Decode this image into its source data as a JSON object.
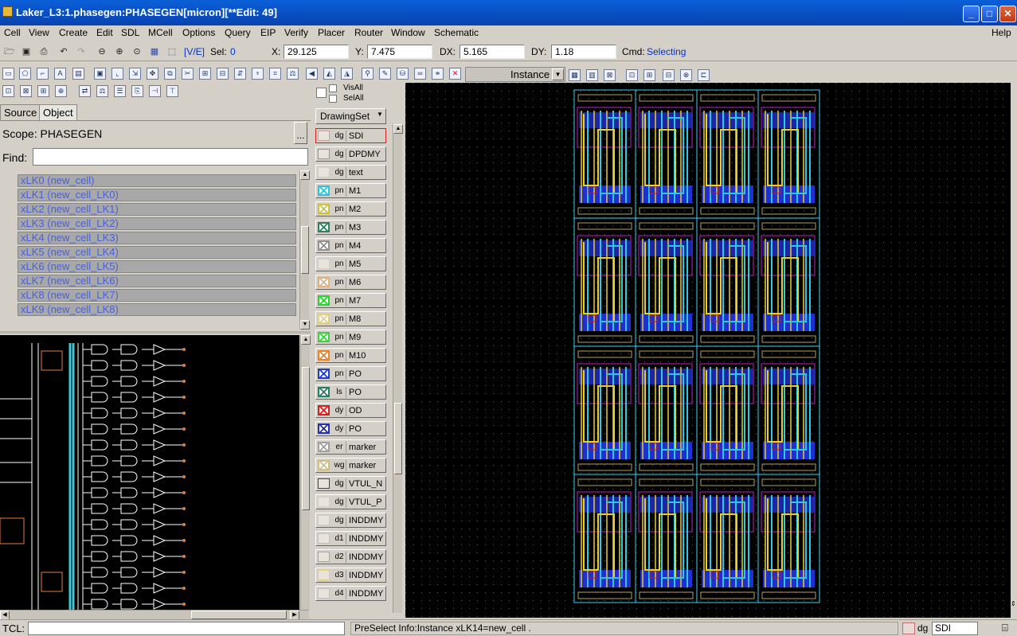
{
  "window": {
    "title": "Laker_L3:1.phasegen:PHASEGEN[micron][**Edit: 49]"
  },
  "menu": [
    "Cell",
    "View",
    "Create",
    "Edit",
    "SDL",
    "MCell",
    "Options",
    "Query",
    "EIP",
    "Verify",
    "Placer",
    "Router",
    "Window",
    "Schematic"
  ],
  "menu_help": "Help",
  "coords": {
    "mode": "[V/E]",
    "sel_label": "Sel:",
    "sel_value": "0",
    "x_label": "X:",
    "x_value": "29.125",
    "y_label": "Y:",
    "y_value": "7.475",
    "dx_label": "DX:",
    "dx_value": "5.165",
    "dy_label": "DY:",
    "dy_value": "1.18",
    "cmd_label": "Cmd:",
    "cmd_value": "Selecting"
  },
  "instance_select": "Instance",
  "vis": {
    "visall": "VisAll",
    "selall": "SelAll"
  },
  "drawing_set": "DrawingSet",
  "tabs": [
    "Source",
    "Object"
  ],
  "scope": {
    "label": "Scope:",
    "value": "PHASEGEN",
    "button": "..."
  },
  "find": {
    "label": "Find:",
    "value": ""
  },
  "cells": [
    "xLK0 (new_cell)",
    "xLK1 (new_cell_LK0)",
    "xLK2 (new_cell_LK1)",
    "xLK3 (new_cell_LK2)",
    "xLK4 (new_cell_LK3)",
    "xLK5 (new_cell_LK4)",
    "xLK6 (new_cell_LK5)",
    "xLK7 (new_cell_LK6)",
    "xLK8 (new_cell_LK7)",
    "xLK9 (new_cell_LK8)"
  ],
  "layers": [
    {
      "purpose": "dg",
      "name": "SDI",
      "color": "#d0a0a0",
      "x": false
    },
    {
      "purpose": "dg",
      "name": "DPDMY",
      "color": "#9090c0",
      "x": false
    },
    {
      "purpose": "dg",
      "name": "text",
      "color": "#d4d0c8",
      "x": false
    },
    {
      "purpose": "pn",
      "name": "M1",
      "color": "#30c0e0",
      "x": true
    },
    {
      "purpose": "pn",
      "name": "M2",
      "color": "#d0c040",
      "x": true
    },
    {
      "purpose": "pn",
      "name": "M3",
      "color": "#308060",
      "x": true
    },
    {
      "purpose": "pn",
      "name": "M4",
      "color": "#909090",
      "x": true
    },
    {
      "purpose": "pn",
      "name": "M5",
      "color": "#d4d0c8",
      "x": false
    },
    {
      "purpose": "pn",
      "name": "M6",
      "color": "#e0b080",
      "x": true
    },
    {
      "purpose": "pn",
      "name": "M7",
      "color": "#30d030",
      "x": true
    },
    {
      "purpose": "pn",
      "name": "M8",
      "color": "#e0d080",
      "x": true
    },
    {
      "purpose": "pn",
      "name": "M9",
      "color": "#40d040",
      "x": true
    },
    {
      "purpose": "pn",
      "name": "M10",
      "color": "#f08020",
      "x": true
    },
    {
      "purpose": "pn",
      "name": "PO",
      "color": "#2040c0",
      "x": true
    },
    {
      "purpose": "ls",
      "name": "PO",
      "color": "#208060",
      "x": true
    },
    {
      "purpose": "dy",
      "name": "OD",
      "color": "#d02020",
      "x": true
    },
    {
      "purpose": "dy",
      "name": "PO",
      "color": "#2030b0",
      "x": true
    },
    {
      "purpose": "er",
      "name": "marker",
      "color": "#a0a0a0",
      "x": true
    },
    {
      "purpose": "wg",
      "name": "marker",
      "color": "#d0c080",
      "x": true
    },
    {
      "purpose": "dg",
      "name": "VTUL_N",
      "color": "#2040c0",
      "x": false
    },
    {
      "purpose": "dg",
      "name": "VTUL_P",
      "color": "#d4d0c8",
      "x": false
    },
    {
      "purpose": "dg",
      "name": "INDDMY",
      "color": "#e0d080",
      "x": false
    },
    {
      "purpose": "d1",
      "name": "INDDMY",
      "color": "#c0c0c0",
      "x": false
    },
    {
      "purpose": "d2",
      "name": "INDDMY",
      "color": "#80c080",
      "x": false
    },
    {
      "purpose": "d3",
      "name": "INDDMY",
      "color": "#e0d080",
      "x": false
    },
    {
      "purpose": "d4",
      "name": "INDDMY",
      "color": "#c0c0c0",
      "x": false
    }
  ],
  "colors": {
    "metal1": "#30c8e0",
    "metal2": "#e8d028",
    "poly": "#2030d0",
    "nwell": "#c020c0",
    "od": "#c81818",
    "boundary": "#40d0f0"
  },
  "status": {
    "tcl_label": "TCL:",
    "preselect": "PreSelect Info:Instance xLK14=new_cell .",
    "layer_purpose": "dg",
    "layer_name": "SDI"
  }
}
